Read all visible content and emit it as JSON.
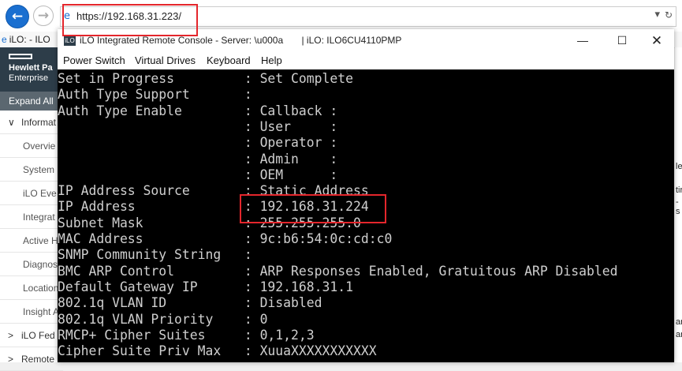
{
  "browser": {
    "back_icon": "back-arrow-icon",
    "forward_icon": "forward-arrow-icon",
    "url": "https://192.168.31.223/",
    "tab_title": "iLO: - ILO"
  },
  "ilo_page": {
    "brand_line1": "Hewlett Pa",
    "brand_line2": "Enterprise",
    "expand_all": "Expand All",
    "nav": [
      {
        "label": "Informat",
        "chev": "∨",
        "type": "sec"
      },
      {
        "label": "Overvie",
        "type": "sub"
      },
      {
        "label": "System",
        "type": "sub"
      },
      {
        "label": "iLO Eve",
        "type": "sub"
      },
      {
        "label": "Integrat",
        "type": "sub"
      },
      {
        "label": "Active H",
        "type": "sub"
      },
      {
        "label": "Diagnos",
        "type": "sub"
      },
      {
        "label": "Location",
        "type": "sub"
      },
      {
        "label": "Insight A",
        "type": "sub"
      },
      {
        "label": "iLO Fed",
        "chev": ">",
        "type": "sec"
      },
      {
        "label": "Remote",
        "chev": ">",
        "type": "sec"
      }
    ]
  },
  "right_strip": [
    "le",
    "tir",
    "-s",
    "ar",
    "ar"
  ],
  "console_window": {
    "logo": "iLO",
    "title": "iLO Integrated Remote Console - Server: \\u000a       | iLO: ILO6CU4110PMP",
    "minimize": "—",
    "maximize": "☐",
    "close": "✕",
    "menu": [
      "Power Switch",
      "Virtual Drives",
      "Keyboard",
      "Help"
    ]
  },
  "terminal": {
    "lines": [
      "Set in Progress         : Set Complete",
      "Auth Type Support       :",
      "Auth Type Enable        : Callback :",
      "                        : User     :",
      "                        : Operator :",
      "                        : Admin    :",
      "                        : OEM      :",
      "IP Address Source       : Static Address",
      "IP Address              : 192.168.31.224",
      "Subnet Mask             : 255.255.255.0",
      "MAC Address             : 9c:b6:54:0c:cd:c0",
      "SNMP Community String   :",
      "BMC ARP Control         : ARP Responses Enabled, Gratuitous ARP Disabled",
      "Default Gateway IP      : 192.168.31.1",
      "802.1q VLAN ID          : Disabled",
      "802.1q VLAN Priority    : 0",
      "RMCP+ Cipher Suites     : 0,1,2,3",
      "Cipher Suite Priv Max   : XuuaXXXXXXXXXXX"
    ]
  },
  "colors": {
    "highlight": "#e4262c",
    "terminal_bg": "#000000",
    "terminal_fg": "#cfcfcf",
    "hpe_header": "#2d3d49"
  }
}
